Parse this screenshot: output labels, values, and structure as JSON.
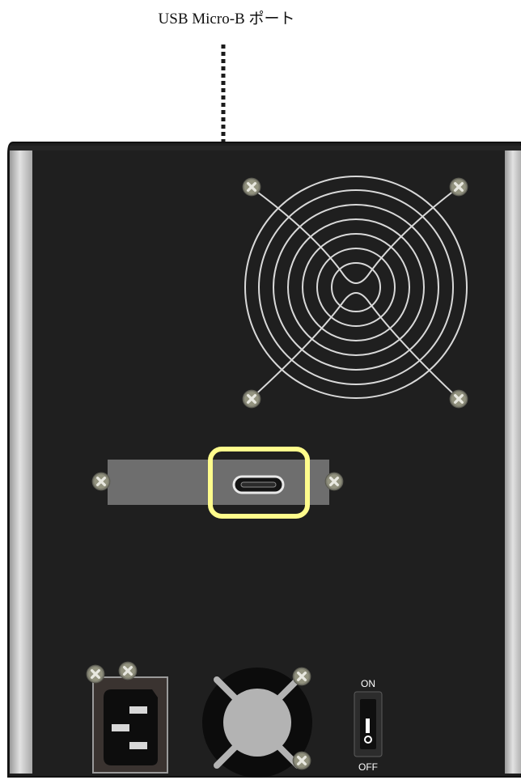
{
  "callout": {
    "label": "USB Micro-B ポート",
    "arrow_color": "#fff27a",
    "highlight_color": "#fffc8c"
  },
  "device": {
    "panel_color": "#1f1f1f",
    "rail_color": "#cfcfcf",
    "usb_plate_color": "#6e6e6e",
    "screw_color": "#8a8a7a"
  },
  "power_switch": {
    "on_label": "ON",
    "off_label": "OFF"
  },
  "icons": [
    "screw-icon",
    "fan-grille-icon",
    "power-inlet-icon",
    "usb-micro-b-port-icon",
    "small-fan-icon",
    "rocker-switch-icon"
  ]
}
